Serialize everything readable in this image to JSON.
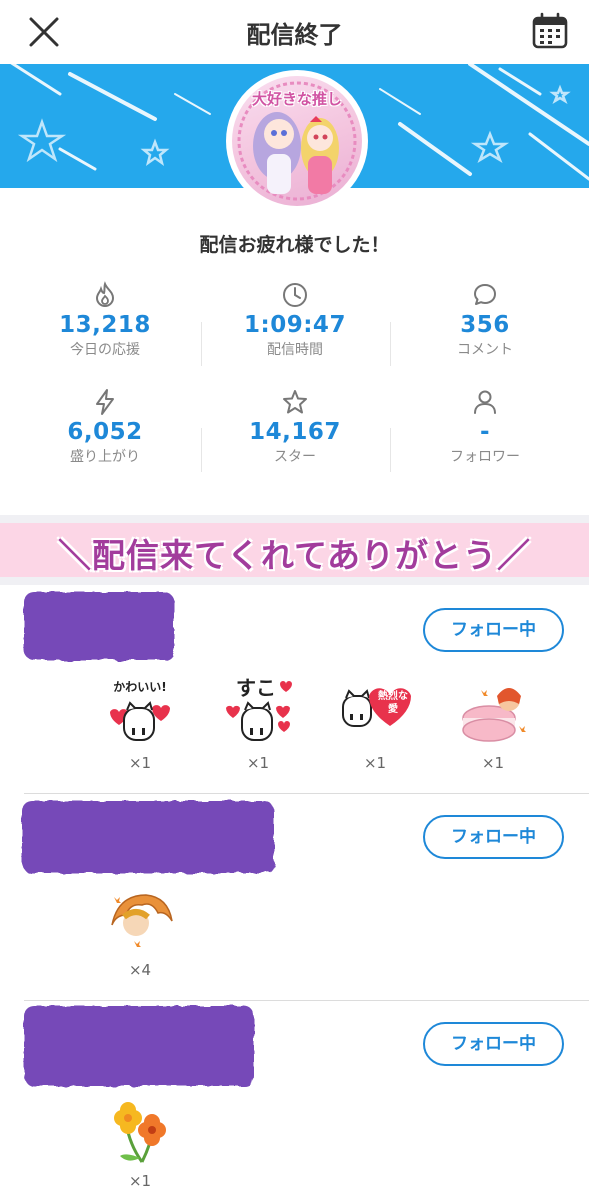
{
  "header": {
    "title": "配信終了",
    "close_icon": "close-icon",
    "calendar_icon": "calendar-icon"
  },
  "banner": {
    "color": "#25a8ec",
    "avatar_caption": "大好きな推し"
  },
  "thanks_message": "配信お疲れ様でした！",
  "stats": [
    {
      "icon": "flame-icon",
      "value": "13,218",
      "label": "今日の応援"
    },
    {
      "icon": "clock-icon",
      "value": "1:09:47",
      "label": "配信時間"
    },
    {
      "icon": "comment-icon",
      "value": "356",
      "label": "コメント"
    },
    {
      "icon": "lightning-icon",
      "value": "6,052",
      "label": "盛り上がり"
    },
    {
      "icon": "star-icon",
      "value": "14,167",
      "label": "スター"
    },
    {
      "icon": "person-icon",
      "value": "-",
      "label": "フォロワー"
    }
  ],
  "thanks_banner": {
    "text": "＼配信来てくれてありがとう／",
    "text_color": "#a23c9c",
    "background": "#fcd6e6"
  },
  "viewers": [
    {
      "follow_label": "フォロー中",
      "gifts": [
        {
          "icon": "kawaii-cat-sticker-icon",
          "sticker_text": "かわいい!",
          "count": "×1"
        },
        {
          "icon": "suko-cat-sticker-icon",
          "sticker_text": "すこ",
          "count": "×1"
        },
        {
          "icon": "love-cat-sticker-icon",
          "sticker_text": "熱烈な愛",
          "count": "×1"
        },
        {
          "icon": "macaron-sticker-icon",
          "count": "×1"
        }
      ]
    },
    {
      "follow_label": "フォロー中",
      "gifts": [
        {
          "icon": "croissant-sticker-icon",
          "count": "×4"
        }
      ]
    },
    {
      "follow_label": "フォロー中",
      "gifts": [
        {
          "icon": "flower-sticker-icon",
          "count": "×1"
        }
      ]
    }
  ],
  "colors": {
    "accent": "#1e88d8",
    "redaction": "#7649b8"
  }
}
